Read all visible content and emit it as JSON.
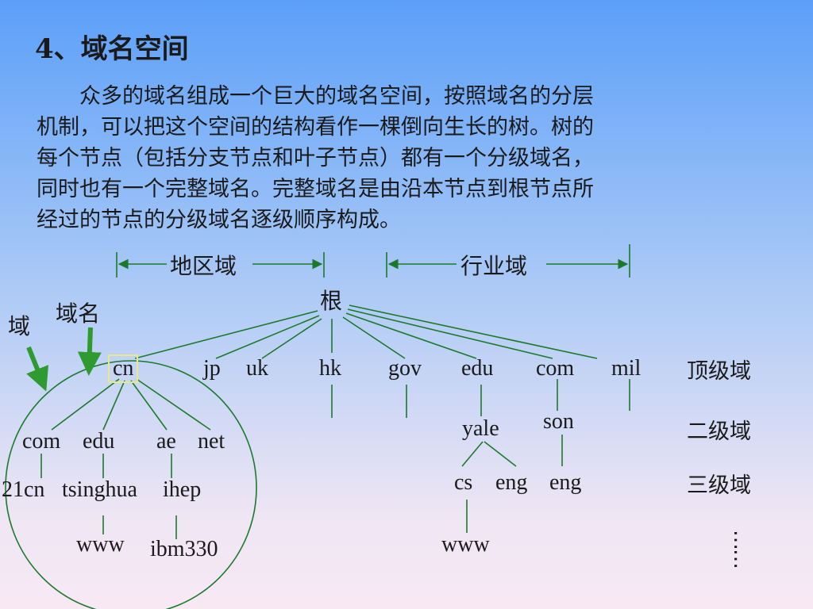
{
  "title": "4、域名空间",
  "paragraph": [
    "　　众多的域名组成一个巨大的域名空间，按照域名的分层",
    "机制，可以把这个空间的结构看作一棵倒向生长的树。树的",
    "每个节点（包括分支节点和叶子节点）都有一个分级域名，",
    "同时也有一个完整域名。完整域名是由沿本节点到根节点所",
    "经过的节点的分级域名逐级顺序构成。"
  ],
  "labels": {
    "region": "地区域",
    "industry": "行业域",
    "root": "根",
    "domain": "域",
    "domain_name": "域名",
    "top_level": "顶级域",
    "second_level": "二级域",
    "third_level": "三级域",
    "ellipsis": "……"
  },
  "tree": {
    "top": [
      "cn",
      "jp",
      "uk",
      "hk",
      "gov",
      "edu",
      "com",
      "mil"
    ],
    "cn_children": [
      "com",
      "edu",
      "ae",
      "net"
    ],
    "cn_grandchildren": [
      "21cn",
      "tsinghua",
      "ihep"
    ],
    "cn_leaves": [
      "www",
      "ibm330"
    ],
    "edu_child": "yale",
    "com_child": "son",
    "yale_children": [
      "cs",
      "eng"
    ],
    "son_child": "eng",
    "cs_child": "www"
  },
  "colors": {
    "line": "#1b7a2a",
    "arrow": "#2f9a2f",
    "highlight": "#e6e88a"
  }
}
